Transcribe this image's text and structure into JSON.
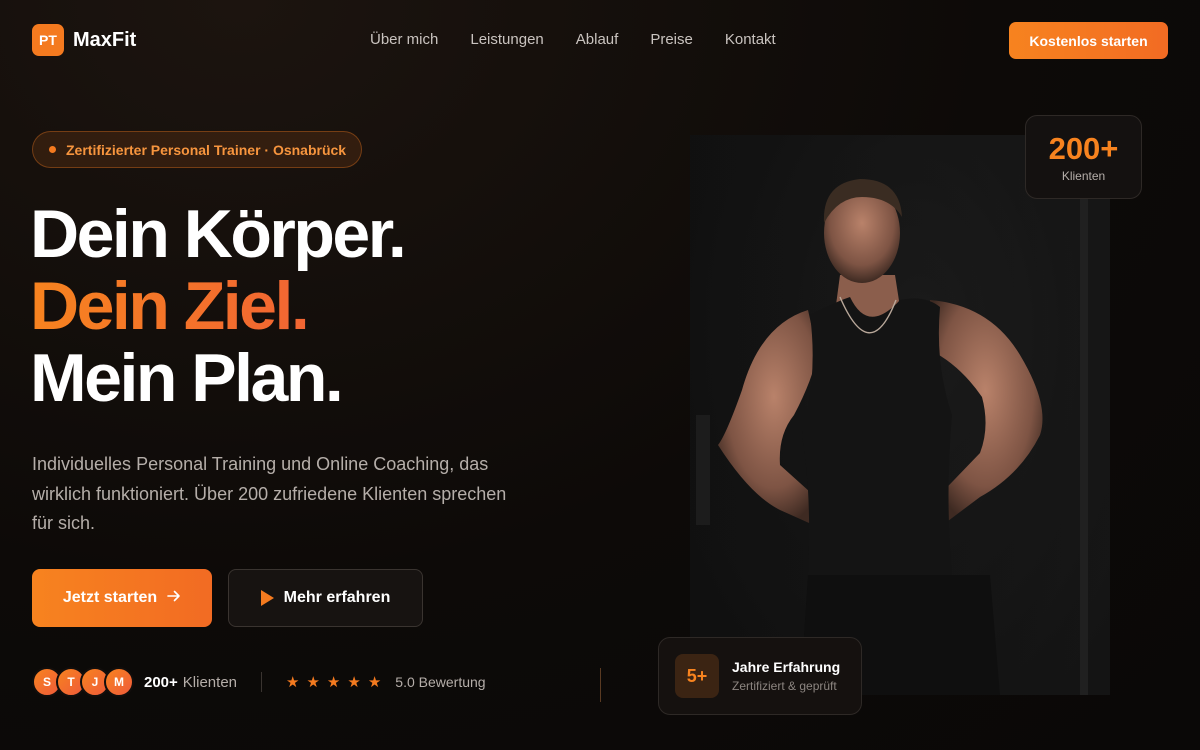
{
  "brand": {
    "badge": "PT",
    "name": "MaxFit"
  },
  "nav": {
    "links": [
      "Über mich",
      "Leistungen",
      "Ablauf",
      "Preise",
      "Kontakt"
    ],
    "cta": "Kostenlos starten"
  },
  "hero": {
    "badge": "Zertifizierter Personal Trainer · Osnabrück",
    "headline": [
      "Dein Körper.",
      "Dein Ziel.",
      "Mein Plan."
    ],
    "lead": "Individuelles Personal Training und Online Coaching, das wirklich funktioniert. Über 200 zufriedene Klienten sprechen für sich.",
    "primary_button": "Jetzt starten",
    "secondary_button": "Mehr erfahren"
  },
  "proof": {
    "avatars": [
      "S",
      "T",
      "J",
      "M"
    ],
    "clients_count": "200+",
    "clients_label": "Klienten",
    "stars": 5,
    "rating": "5.0 Bewertung"
  },
  "stat_card": {
    "value": "200+",
    "label": "Klienten"
  },
  "experience_card": {
    "value": "5+",
    "title": "Jahre Erfahrung",
    "subtitle": "Zertifiziert & geprüft"
  },
  "colors": {
    "accent": "#f47a1f",
    "accent_red": "#ef5a3a",
    "background": "#0d0a08"
  }
}
